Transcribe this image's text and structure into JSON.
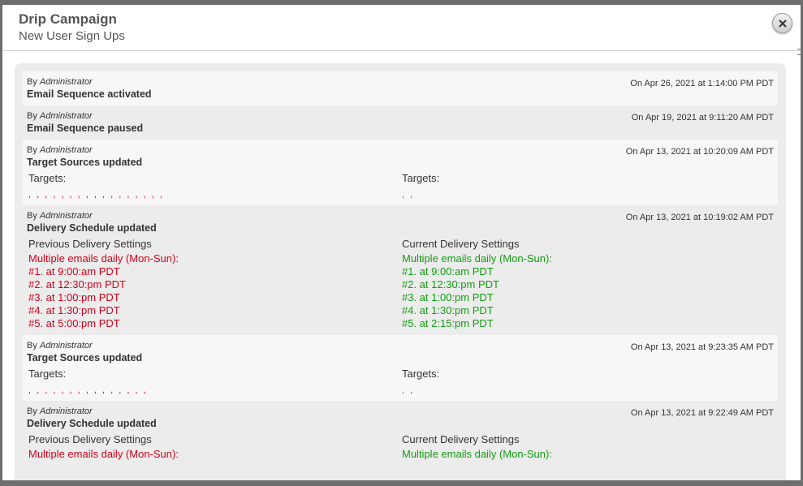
{
  "modal": {
    "title": "Drip Campaign",
    "subtitle": "New User Sign Ups"
  },
  "entries": [
    {
      "by_prefix": "By",
      "by_user": "Administrator",
      "action": "Email Sequence activated",
      "date": "On Apr 26, 2021 at 1:14:00 PM PDT"
    },
    {
      "by_prefix": "By",
      "by_user": "Administrator",
      "action": "Email Sequence paused",
      "date": "On Apr 19, 2021 at 9:11:20 AM PDT"
    },
    {
      "by_prefix": "By",
      "by_user": "Administrator",
      "action": "Target Sources updated",
      "date": "On Apr 13, 2021 at 10:20:09 AM PDT",
      "left_head": "Targets:",
      "left_value": ", , , , , , , , , , , , , , , , ,",
      "right_head": "Targets:",
      "right_value": ", ,"
    },
    {
      "by_prefix": "By",
      "by_user": "Administrator",
      "action": "Delivery Schedule updated",
      "date": "On Apr 13, 2021 at 10:19:02 AM PDT",
      "left_head": "Previous Delivery Settings",
      "left_lines": [
        "Multiple emails daily (Mon-Sun):",
        "#1. at 9:00:am PDT",
        "#2. at 12:30:pm PDT",
        "#3. at 1:00:pm PDT",
        "#4. at 1:30:pm PDT",
        "#5. at 5:00:pm PDT"
      ],
      "right_head": "Current Delivery Settings",
      "right_lines": [
        "Multiple emails daily (Mon-Sun):",
        "#1. at 9:00:am PDT",
        "#2. at 12:30:pm PDT",
        "#3. at 1:00:pm PDT",
        "#4. at 1:30:pm PDT",
        "#5. at 2:15:pm PDT"
      ]
    },
    {
      "by_prefix": "By",
      "by_user": "Administrator",
      "action": "Target Sources updated",
      "date": "On Apr 13, 2021 at 9:23:35 AM PDT",
      "left_head": "Targets:",
      "left_value": ", , , , , , , , , , , , , , ,",
      "right_head": "Targets:",
      "right_value": ", ,"
    },
    {
      "by_prefix": "By",
      "by_user": "Administrator",
      "action": "Delivery Schedule updated",
      "date": "On Apr 13, 2021 at 9:22:49 AM PDT",
      "left_head": "Previous Delivery Settings",
      "left_lines": [
        "Multiple emails daily (Mon-Sun):"
      ],
      "right_head": "Current Delivery Settings",
      "right_lines": [
        "Multiple emails daily (Mon-Sun):"
      ]
    }
  ],
  "colors": {
    "previous": "#d0021b",
    "current": "#119e11"
  },
  "icons": {
    "close": "close-icon"
  }
}
